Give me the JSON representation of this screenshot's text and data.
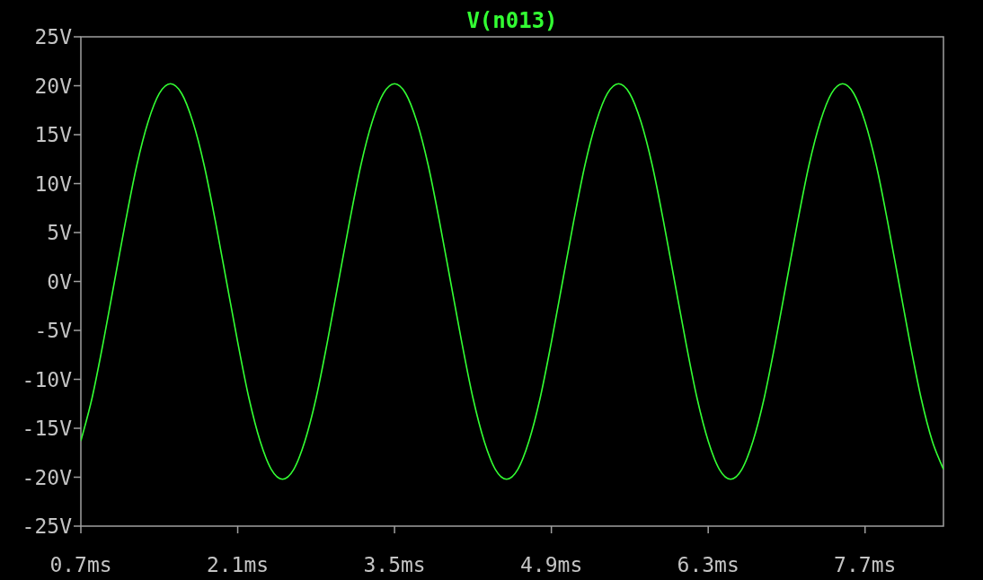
{
  "plot": {
    "chart_data": {
      "type": "line",
      "title": "V(n013)",
      "x": [
        0.7,
        0.8,
        0.9,
        1.0,
        1.1,
        1.2,
        1.3,
        1.4,
        1.5,
        1.6,
        1.7,
        1.8,
        1.9,
        2.0,
        2.1,
        2.2,
        2.3,
        2.4,
        2.5,
        2.6,
        2.7,
        2.8,
        2.9,
        3.0,
        3.1,
        3.2,
        3.3,
        3.4,
        3.5,
        3.6,
        3.7,
        3.8,
        3.9,
        4.0,
        4.1,
        4.2,
        4.3,
        4.4,
        4.5,
        4.6,
        4.7,
        4.8,
        4.9,
        5.0,
        5.1,
        5.2,
        5.3,
        5.4,
        5.5,
        5.6,
        5.7,
        5.8,
        5.9,
        6.0,
        6.1,
        6.2,
        6.3,
        6.4,
        6.5,
        6.6,
        6.7,
        6.8,
        6.9,
        7.0,
        7.1,
        7.2,
        7.3,
        7.4,
        7.5,
        7.6,
        7.7,
        7.8,
        7.9,
        8.0,
        8.1,
        8.2,
        8.3,
        8.4
      ],
      "series": [
        {
          "color": "#33ff33",
          "values": [
            -16.3,
            -11.9,
            -6.2,
            0,
            6.2,
            11.9,
            16.3,
            19.2,
            20.2,
            19.2,
            16.3,
            11.9,
            6.2,
            0,
            -6.2,
            -11.9,
            -16.3,
            -19.2,
            -20.2,
            -19.2,
            -16.3,
            -11.9,
            -6.2,
            0,
            6.2,
            11.9,
            16.3,
            19.2,
            20.2,
            19.2,
            16.3,
            11.9,
            6.2,
            0,
            -6.2,
            -11.9,
            -16.3,
            -19.2,
            -20.2,
            -19.2,
            -16.3,
            -11.9,
            -6.2,
            0,
            6.2,
            11.9,
            16.3,
            19.2,
            20.2,
            19.2,
            16.3,
            11.9,
            6.2,
            0,
            -6.2,
            -11.9,
            -16.3,
            -19.2,
            -20.2,
            -19.2,
            -16.3,
            -11.9,
            -6.2,
            0,
            6.2,
            11.9,
            16.3,
            19.2,
            20.2,
            19.2,
            16.3,
            11.9,
            6.2,
            0,
            -6.2,
            -11.9,
            -16.3,
            -19.2
          ]
        }
      ],
      "xlim": [
        0.7,
        8.4
      ],
      "ylim": [
        -25,
        25
      ],
      "xticks": [
        {
          "value": 0.7,
          "label": "0.7ms"
        },
        {
          "value": 2.1,
          "label": "2.1ms"
        },
        {
          "value": 3.5,
          "label": "3.5ms"
        },
        {
          "value": 4.9,
          "label": "4.9ms"
        },
        {
          "value": 6.3,
          "label": "6.3ms"
        },
        {
          "value": 7.7,
          "label": "7.7ms"
        }
      ],
      "yticks": [
        {
          "value": 25,
          "label": "25V"
        },
        {
          "value": 20,
          "label": "20V"
        },
        {
          "value": 15,
          "label": "15V"
        },
        {
          "value": 10,
          "label": "10V"
        },
        {
          "value": 5,
          "label": "5V"
        },
        {
          "value": 0,
          "label": "0V"
        },
        {
          "value": -5,
          "label": "-5V"
        },
        {
          "value": -10,
          "label": "-10V"
        },
        {
          "value": -15,
          "label": "-15V"
        },
        {
          "value": -20,
          "label": "-20V"
        },
        {
          "value": -25,
          "label": "-25V"
        }
      ]
    }
  }
}
